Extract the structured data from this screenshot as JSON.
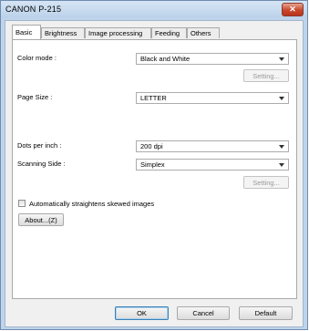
{
  "window": {
    "title": "CANON P-215",
    "close_glyph": "✕"
  },
  "tabs": [
    {
      "label": "Basic"
    },
    {
      "label": "Brightness"
    },
    {
      "label": "Image processing"
    },
    {
      "label": "Feeding"
    },
    {
      "label": "Others"
    }
  ],
  "basic": {
    "color_mode_label": "Color mode :",
    "color_mode_value": "Black and White",
    "color_setting_button": "Setting...",
    "page_size_label": "Page Size :",
    "page_size_value": "LETTER",
    "dpi_label": "Dots per inch :",
    "dpi_value": "200 dpi",
    "scanning_side_label": "Scanning Side :",
    "scanning_side_value": "Simplex",
    "side_setting_button": "Setting...",
    "straighten_label": "Automatically straightens skewed images",
    "straighten_checked": false,
    "about_button": "About...(Z)"
  },
  "footer": {
    "ok_button": "OK",
    "cancel_button": "Cancel",
    "default_button": "Default"
  },
  "icons": {
    "close": "close-icon",
    "dropdown": "chevron-down-icon"
  }
}
